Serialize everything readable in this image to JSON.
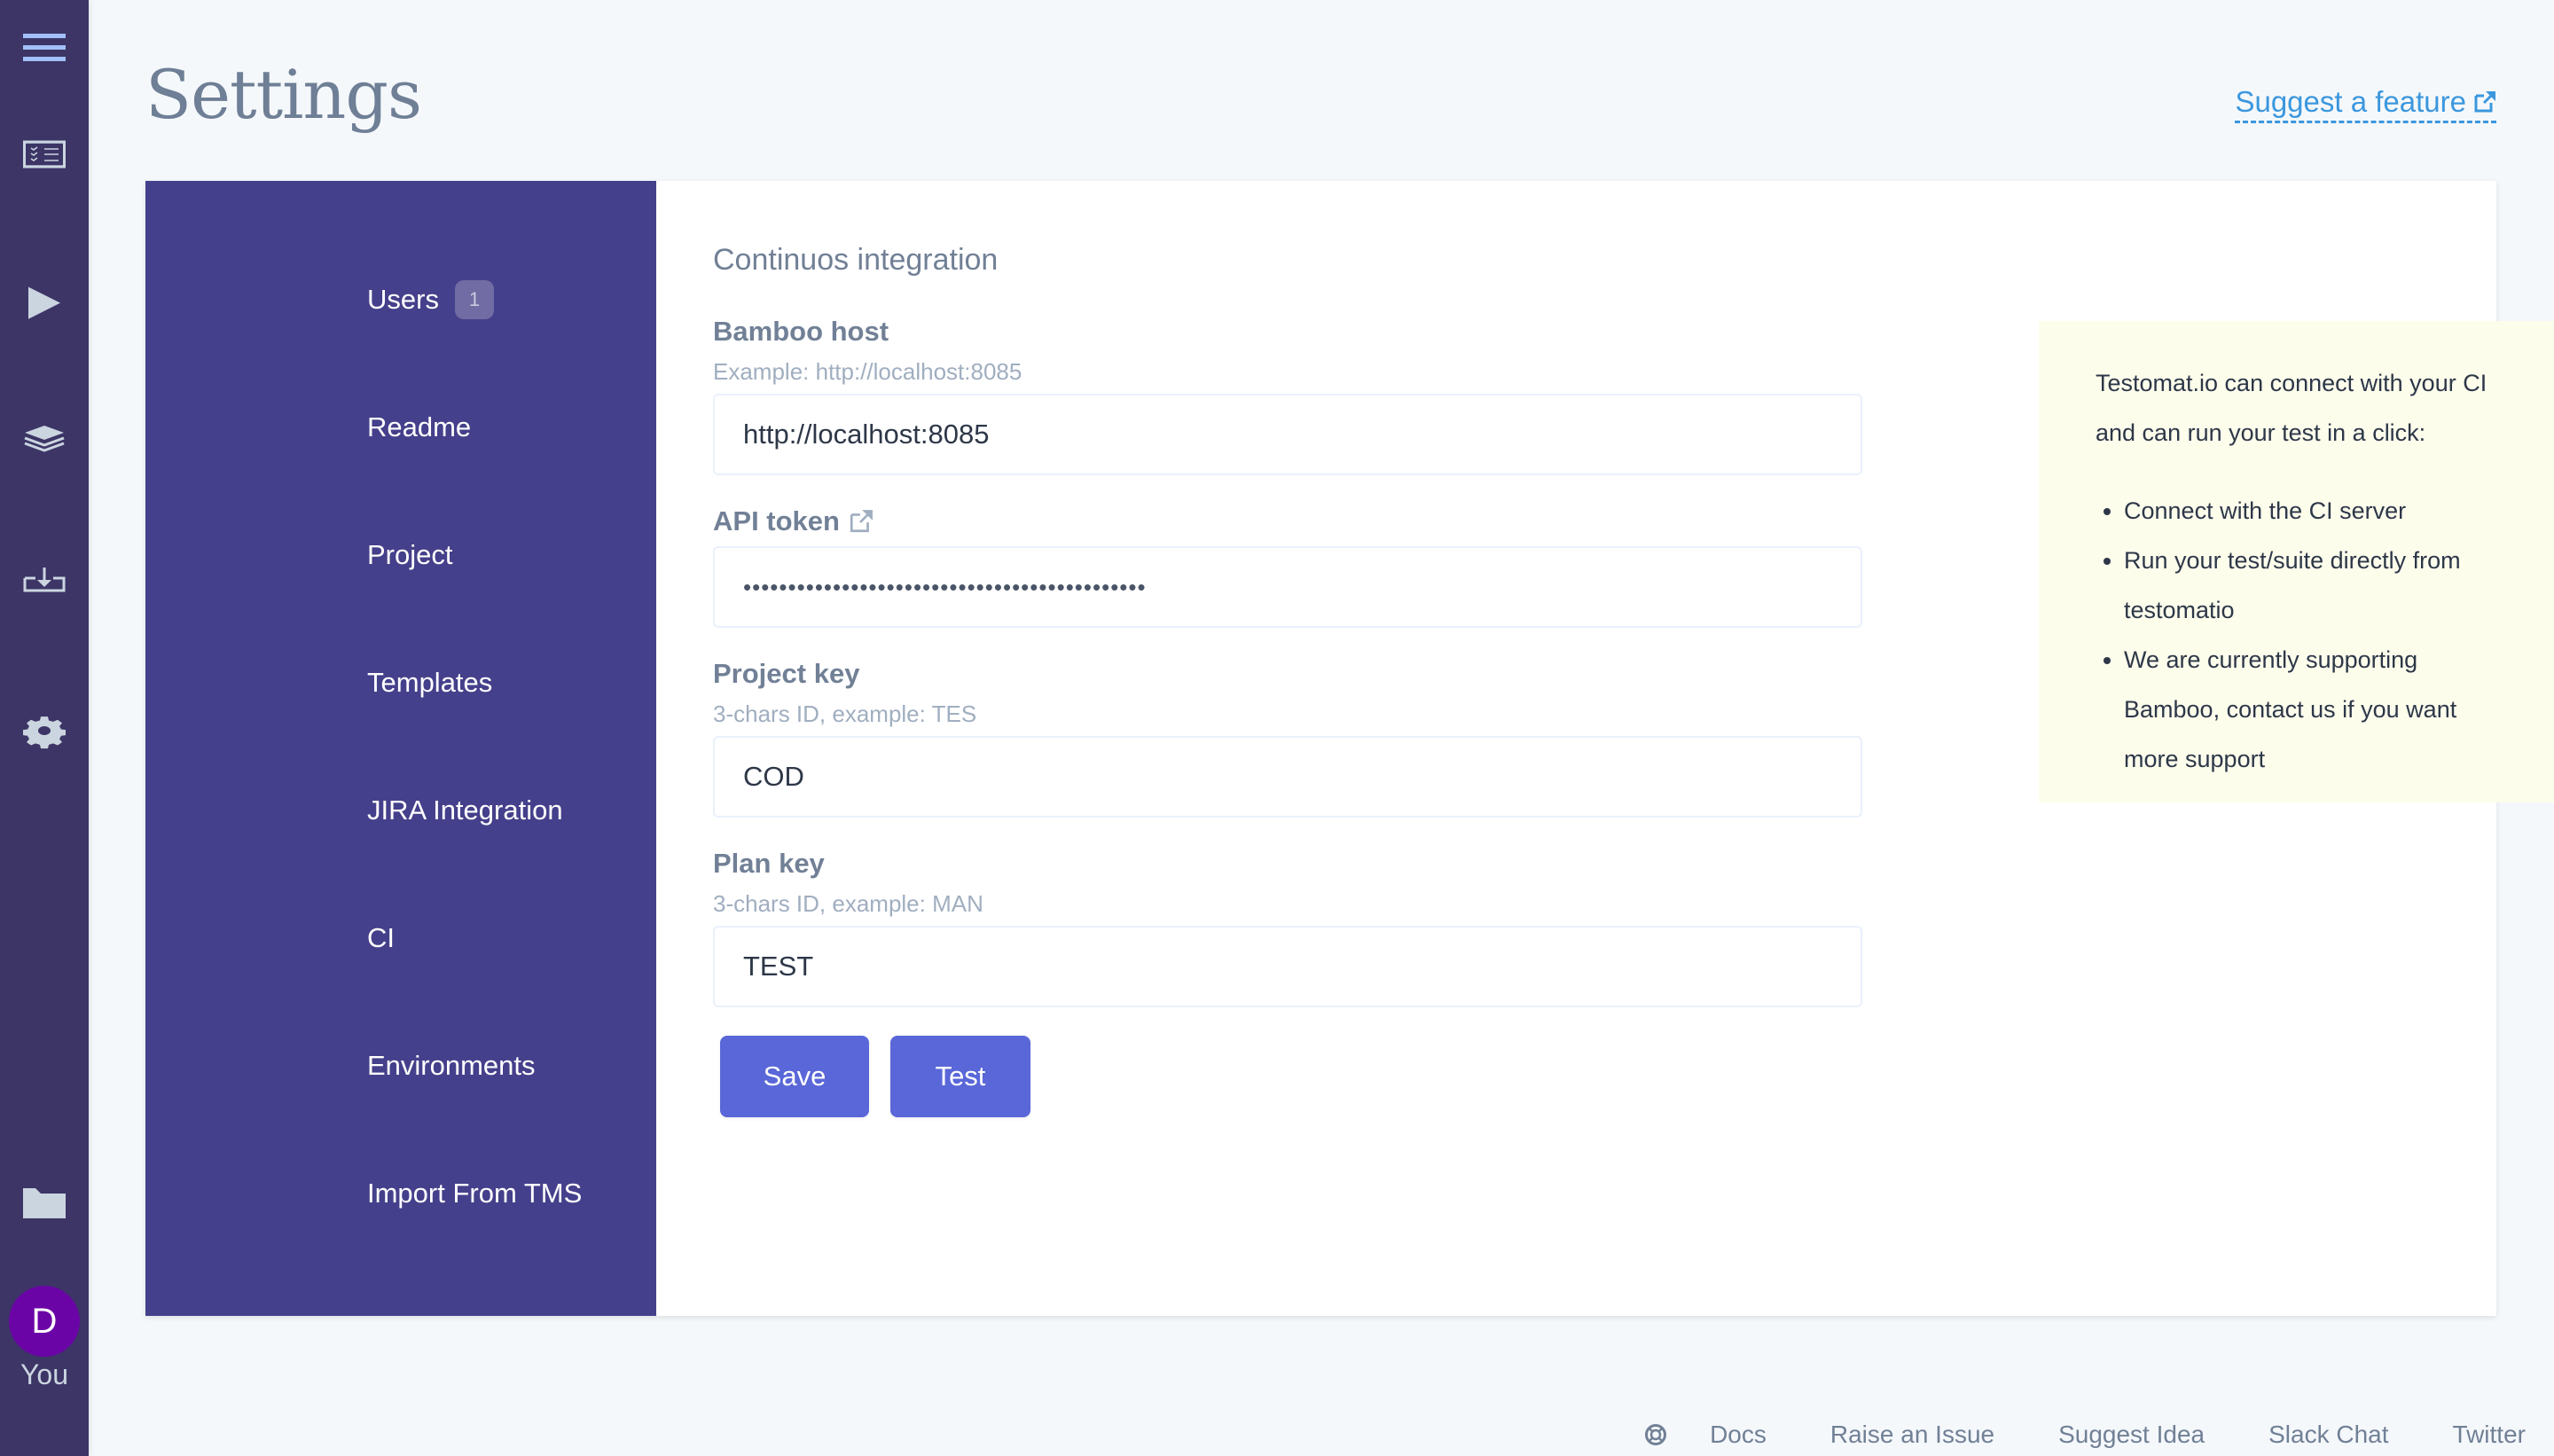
{
  "sidebar": {
    "icons": [
      {
        "name": "menu-icon"
      },
      {
        "name": "tests-checklist-icon"
      },
      {
        "name": "runs-play-icon"
      },
      {
        "name": "layers-icon"
      },
      {
        "name": "import-icon"
      },
      {
        "name": "gear-icon"
      },
      {
        "name": "folder-icon"
      }
    ],
    "avatar_initial": "D",
    "avatar_label": "You",
    "colors": {
      "background": "#3c3566",
      "icon": "#cbd5e0",
      "menu_icon": "#a3bffa",
      "avatar": "#6b04a6"
    }
  },
  "header": {
    "title": "Settings",
    "suggest_link": "Suggest a feature"
  },
  "settings_nav": {
    "items": [
      {
        "label": "Users",
        "badge": "1"
      },
      {
        "label": "Readme"
      },
      {
        "label": "Project"
      },
      {
        "label": "Templates"
      },
      {
        "label": "JIRA Integration"
      },
      {
        "label": "CI",
        "active": true
      },
      {
        "label": "Environments"
      },
      {
        "label": "Import From TMS"
      }
    ],
    "background": "#45408b"
  },
  "form": {
    "title": "Continuos integration",
    "fields": [
      {
        "label": "Bamboo host",
        "hint": "Example: http://localhost:8085",
        "value": "http://localhost:8085"
      },
      {
        "label": "API token",
        "hint": "",
        "value": "•••••••••••••••••••••••••••••••••••••••••••••",
        "type": "password",
        "has_external_link": true
      },
      {
        "label": "Project key",
        "hint": "3-chars ID, example: TES",
        "value": "COD"
      },
      {
        "label": "Plan key",
        "hint": "3-chars ID, example: MAN",
        "value": "TEST"
      }
    ],
    "save_label": "Save",
    "test_label": "Test",
    "button_color": "#5a67d8"
  },
  "info": {
    "intro": "Testomat.io can connect with your CI and can run your test in a click:",
    "bullets": [
      "Connect with the CI server",
      "Run your test/suite directly from testomatio",
      "We are currently supporting Bamboo, contact us if you want more support"
    ],
    "background": "#fdfdec"
  },
  "footer": {
    "links": [
      "Docs",
      "Raise an Issue",
      "Suggest Idea",
      "Slack Chat",
      "Twitter"
    ]
  }
}
